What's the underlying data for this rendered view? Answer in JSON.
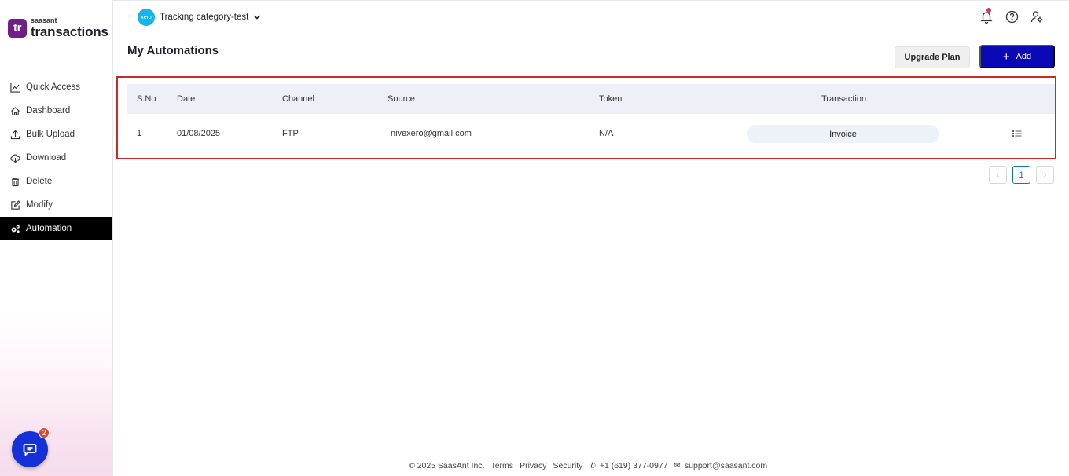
{
  "brand": {
    "small": "saasant",
    "big": "transactions",
    "badge": "tr"
  },
  "sidebar": {
    "items": [
      {
        "label": "Quick Access",
        "icon": "chart-line-icon"
      },
      {
        "label": "Dashboard",
        "icon": "home-icon"
      },
      {
        "label": "Bulk Upload",
        "icon": "upload-icon"
      },
      {
        "label": "Download",
        "icon": "cloud-download-icon"
      },
      {
        "label": "Delete",
        "icon": "trash-icon"
      },
      {
        "label": "Modify",
        "icon": "edit-icon"
      },
      {
        "label": "Automation",
        "icon": "gears-icon",
        "active": true
      }
    ]
  },
  "chat": {
    "badge": "2"
  },
  "topbar": {
    "org_name": "Tracking category-test",
    "org_logo_text": "xero"
  },
  "main": {
    "title": "My Automations",
    "upgrade_label": "Upgrade Plan",
    "add_label": "Add",
    "table": {
      "columns": [
        "S.No",
        "Date",
        "Channel",
        "Source",
        "Token",
        "Transaction"
      ],
      "rows": [
        {
          "sno": "1",
          "date": "01/08/2025",
          "channel": "FTP",
          "source": "nivexero@gmail.com",
          "token": "N/A",
          "transaction": "Invoice"
        }
      ]
    },
    "pagination": {
      "current": "1",
      "prev": "‹",
      "next": "›"
    }
  },
  "footer": {
    "copyright": "© 2025 SaasAnt Inc.",
    "terms": "Terms",
    "privacy": "Privacy",
    "security": "Security",
    "phone": "+1 (619) 377-0977",
    "email": "support@saasant.com"
  },
  "colors": {
    "accent": "#0b09b5",
    "highlight": "#c9282d",
    "brand": "#6d1f87",
    "chat": "#1431d8"
  }
}
